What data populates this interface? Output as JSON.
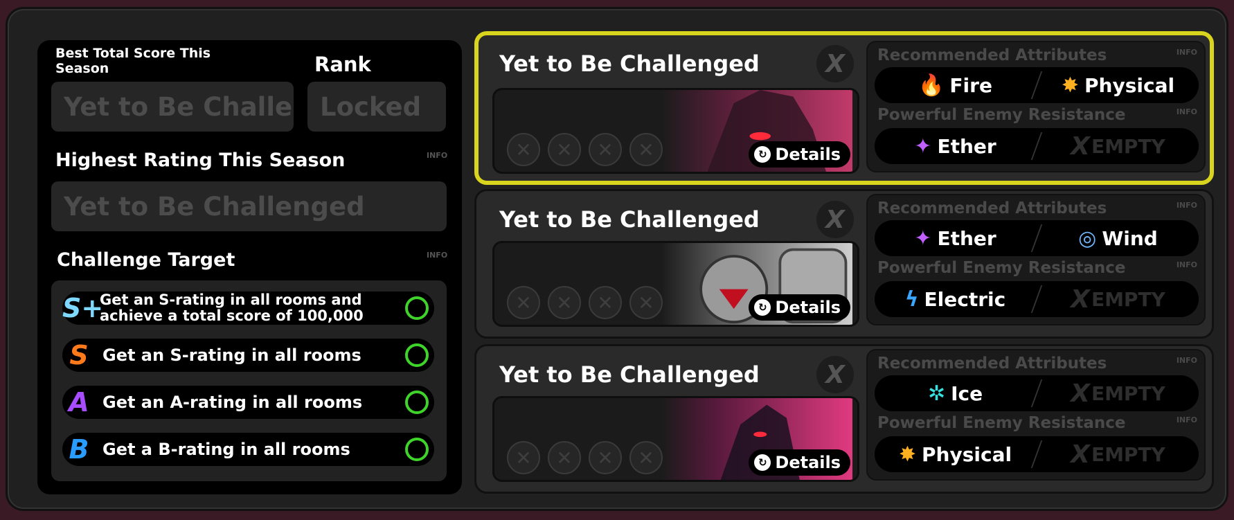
{
  "left_panel": {
    "best_total_label": "Best Total Score This Season",
    "best_total_value": "Yet to Be Challenged",
    "rank_label": "Rank",
    "rank_value": "Locked",
    "highest_rating_label": "Highest Rating This Season",
    "highest_rating_value": "Yet to Be Challenged",
    "info": "INFO",
    "challenge_target_label": "Challenge Target",
    "targets": [
      {
        "grade": "S+",
        "text": "Get an S-rating in all rooms and achieve a total score of 100,000",
        "color": "#7fd8ff"
      },
      {
        "grade": "S",
        "text": "Get an S-rating in all rooms",
        "color": "#ff7a1a"
      },
      {
        "grade": "A",
        "text": "Get an A-rating in all rooms",
        "color": "#a84cff"
      },
      {
        "grade": "B",
        "text": "Get a B-rating in all rooms",
        "color": "#2a9bff"
      }
    ]
  },
  "cards": [
    {
      "title": "Yet to Be Challenged",
      "close": "X",
      "details": "Details",
      "selected": true,
      "recommended_label": "Recommended Attributes",
      "resistance_label": "Powerful Enemy Resistance",
      "info": "INFO",
      "recommended": [
        {
          "name": "Fire",
          "icon": "fire-icon",
          "glyph": "🔥"
        },
        {
          "name": "Physical",
          "icon": "physical-icon",
          "glyph": "✸"
        }
      ],
      "resistance": [
        {
          "name": "Ether",
          "icon": "ether-icon",
          "glyph": "✦"
        },
        {
          "name": "EMPTY",
          "icon": "empty-x-icon",
          "glyph": "X"
        }
      ]
    },
    {
      "title": "Yet to Be Challenged",
      "close": "X",
      "details": "Details",
      "selected": false,
      "recommended_label": "Recommended Attributes",
      "resistance_label": "Powerful Enemy Resistance",
      "info": "INFO",
      "recommended": [
        {
          "name": "Ether",
          "icon": "ether-icon",
          "glyph": "✦"
        },
        {
          "name": "Wind",
          "icon": "wind-icon",
          "glyph": "◎"
        }
      ],
      "resistance": [
        {
          "name": "Electric",
          "icon": "electric-icon",
          "glyph": "ϟ"
        },
        {
          "name": "EMPTY",
          "icon": "empty-x-icon",
          "glyph": "X"
        }
      ]
    },
    {
      "title": "Yet to Be Challenged",
      "close": "X",
      "details": "Details",
      "selected": false,
      "recommended_label": "Recommended Attributes",
      "resistance_label": "Powerful Enemy Resistance",
      "info": "INFO",
      "recommended": [
        {
          "name": "Ice",
          "icon": "ice-icon",
          "glyph": "✲"
        },
        {
          "name": "EMPTY",
          "icon": "empty-x-icon",
          "glyph": "X"
        }
      ],
      "resistance": [
        {
          "name": "Physical",
          "icon": "physical-icon",
          "glyph": "✸"
        },
        {
          "name": "EMPTY",
          "icon": "empty-x-icon",
          "glyph": "X"
        }
      ]
    }
  ],
  "colors": {
    "selected_border": "#d9d41e",
    "complete_ring": "#3fd42a",
    "fire": "#ff5a1a",
    "physical": "#ffb020",
    "ether": "#c060ff",
    "wind": "#6fb8ff",
    "electric": "#3aa6ff",
    "ice": "#39e0e0"
  }
}
